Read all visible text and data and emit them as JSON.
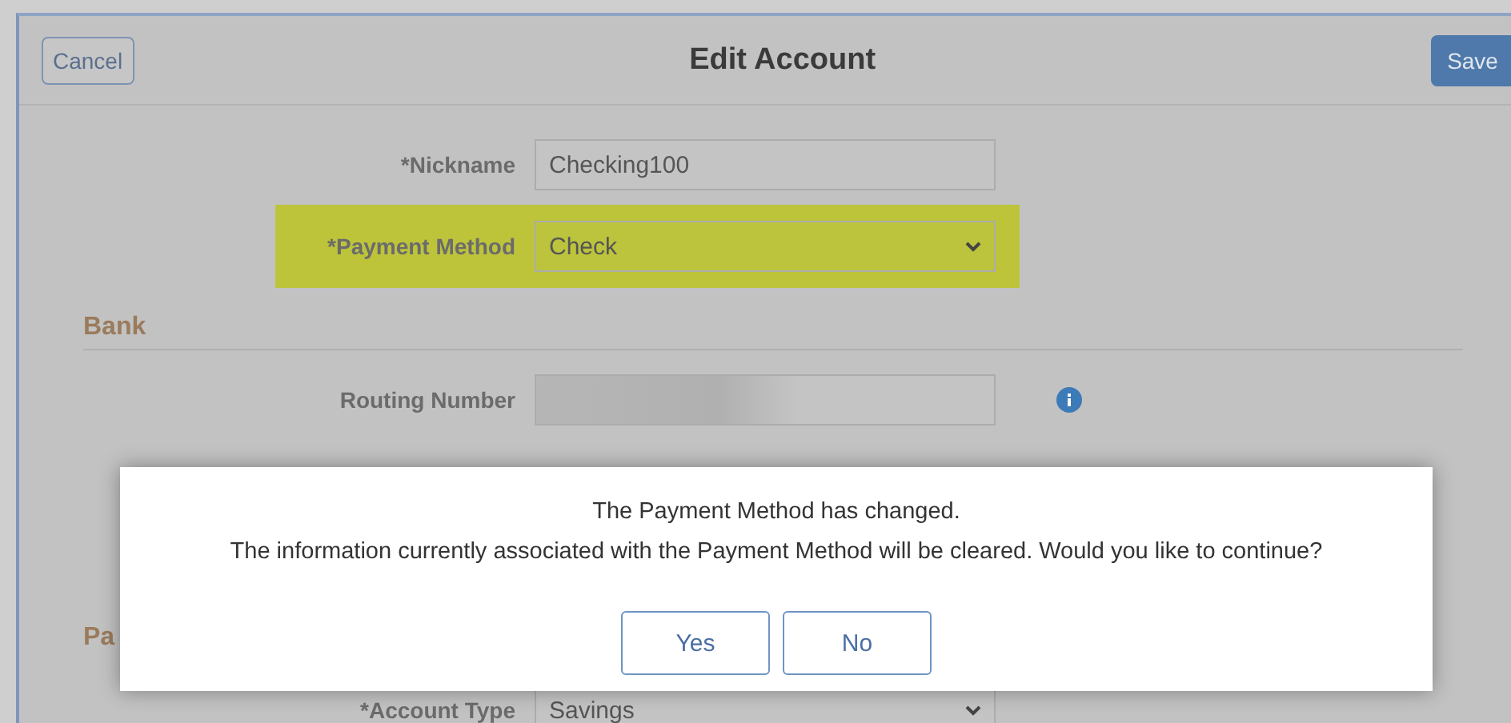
{
  "header": {
    "cancel": "Cancel",
    "title": "Edit Account",
    "save": "Save"
  },
  "fields": [
    {
      "label": "*Nickname",
      "kind": "text",
      "value": "Checking100"
    },
    {
      "label": "*Payment Method",
      "kind": "select",
      "value": "Check",
      "highlighted": true
    }
  ],
  "bank": {
    "title": "Bank",
    "fields": [
      {
        "label": "Routing Number",
        "kind": "masked",
        "info": true
      }
    ]
  },
  "section_2": {
    "title": "Pa",
    "fields": [
      {
        "label": "*Account Type",
        "kind": "select",
        "value": "Savings"
      }
    ]
  },
  "dialog": {
    "lines": [
      "The Payment Method has changed.",
      "The information currently associated with the Payment Method will be cleared. Would you like to continue?"
    ],
    "buttons": [
      "Yes",
      "No"
    ]
  }
}
